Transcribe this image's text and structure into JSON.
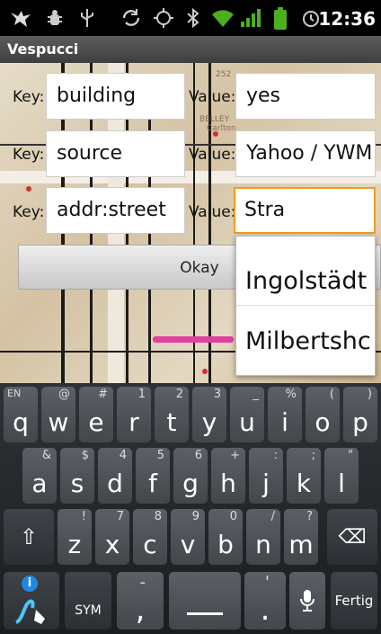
{
  "status_bar": {
    "icons": [
      "bird-icon",
      "debug-icon",
      "usb-icon",
      "sync-icon",
      "gps-icon",
      "bluetooth-icon",
      "wifi-icon",
      "signal-icon",
      "battery-icon",
      "alarm-icon"
    ],
    "time": "12:36"
  },
  "app": {
    "title": "Vespucci"
  },
  "map": {
    "labels": [
      "252",
      "BELLEY",
      "Carlton"
    ]
  },
  "tag_editor": {
    "rows": [
      {
        "key_label": "Key:",
        "key": "building",
        "value_label": "Value:",
        "value": "yes"
      },
      {
        "key_label": "Key:",
        "key": "source",
        "value_label": "Value:",
        "value": "Yahoo / YWM"
      },
      {
        "key_label": "Key:",
        "key": "addr:street",
        "value_label": "Value:",
        "value": "Stra"
      }
    ],
    "okay_label": "Okay",
    "suggestions": [
      "Ingolstädt",
      "Milbertshc"
    ]
  },
  "keyboard": {
    "row1": [
      {
        "main": "q",
        "sub": "EN"
      },
      {
        "main": "w",
        "sub": "@"
      },
      {
        "main": "e",
        "sub": "#"
      },
      {
        "main": "r",
        "sub": "1"
      },
      {
        "main": "t",
        "sub": "2"
      },
      {
        "main": "y",
        "sub": "3"
      },
      {
        "main": "u",
        "sub": "_"
      },
      {
        "main": "i",
        "sub": "%"
      },
      {
        "main": "o",
        "sub": "("
      },
      {
        "main": "p",
        "sub": ")"
      }
    ],
    "row2": [
      {
        "main": "a",
        "sub": "&"
      },
      {
        "main": "s",
        "sub": "$"
      },
      {
        "main": "d",
        "sub": "4"
      },
      {
        "main": "f",
        "sub": "5"
      },
      {
        "main": "g",
        "sub": "6"
      },
      {
        "main": "h",
        "sub": "+"
      },
      {
        "main": "j",
        "sub": ":"
      },
      {
        "main": "k",
        "sub": ";"
      },
      {
        "main": "l",
        "sub": "\""
      }
    ],
    "row3": [
      {
        "main": "z",
        "sub": "!"
      },
      {
        "main": "x",
        "sub": "7"
      },
      {
        "main": "c",
        "sub": "8"
      },
      {
        "main": "v",
        "sub": "9"
      },
      {
        "main": "b",
        "sub": "0"
      },
      {
        "main": "n",
        "sub": "/"
      },
      {
        "main": "m",
        "sub": "?"
      }
    ],
    "shift": "⇧",
    "delete": "⌫",
    "sym": "SYM",
    "comma": ",",
    "comma_sub": "-",
    "period": ".",
    "period_sub": "'",
    "done": "Fertig",
    "settings_badge": "i"
  }
}
